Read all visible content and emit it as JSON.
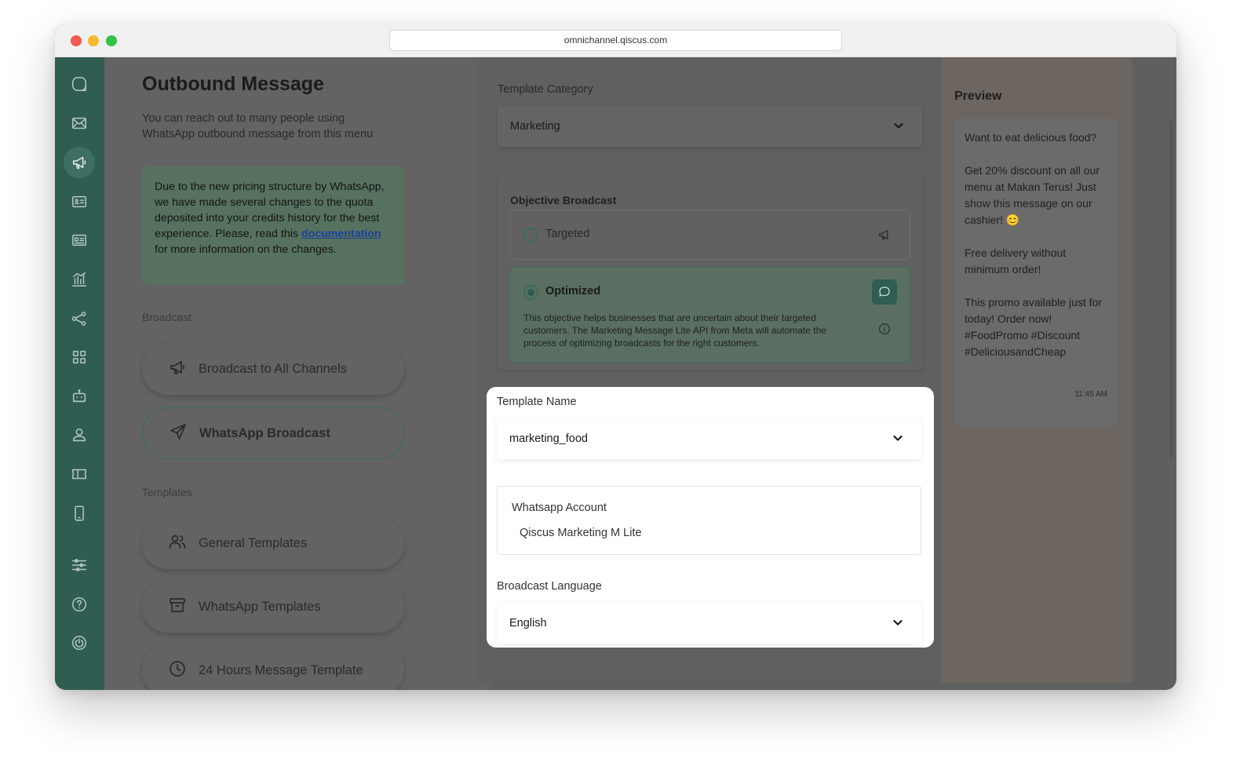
{
  "browser": {
    "url": "omnichannel.qiscus.com"
  },
  "sidebar": {
    "icons": [
      "logo-icon",
      "mail-icon",
      "megaphone-icon",
      "contact-card-icon",
      "id-card-icon",
      "analytics-icon",
      "integration-icon",
      "apps-grid-icon",
      "bot-icon",
      "agent-icon",
      "ticket-icon",
      "mobile-icon",
      "settings-sliders-icon",
      "help-icon",
      "power-icon"
    ],
    "active": "megaphone-icon"
  },
  "left": {
    "title": "Outbound Message",
    "subtitle": "You can reach out to many people using WhatsApp outbound message from this menu",
    "notice": {
      "text_before": "Due to the new pricing structure by WhatsApp, we have made several changes to the quota deposited into your credits history for the best experience. Please, read this ",
      "link": "documentation",
      "text_after": " for more information on the changes."
    },
    "broadcast_label": "Broadcast",
    "broadcast_items": [
      {
        "label": "Broadcast to All Channels",
        "icon": "megaphone-icon"
      },
      {
        "label": "WhatsApp Broadcast",
        "icon": "send-icon",
        "active": true
      }
    ],
    "templates_label": "Templates",
    "template_items": [
      {
        "label": "General Templates",
        "icon": "users-icon"
      },
      {
        "label": "WhatsApp Templates",
        "icon": "archive-icon"
      },
      {
        "label": "24 Hours Message Template",
        "icon": "clock-icon"
      }
    ]
  },
  "form": {
    "template_category": {
      "label": "Template Category",
      "value": "Marketing"
    },
    "objective": {
      "title": "Objective Broadcast",
      "options": [
        {
          "label": "Targeted",
          "selected": false,
          "icon": "megaphone-icon"
        },
        {
          "label": "Optimized",
          "selected": true,
          "icon": "chat-bubble-icon",
          "description": "This objective helps businesses that are uncertain about their targeted customers. The Marketing Message Lite API from Meta will automate the process of optimizing broadcasts for the right customers."
        }
      ]
    },
    "template_name": {
      "label": "Template Name",
      "value": "marketing_food"
    },
    "whatsapp_account": {
      "label": "Whatsapp Account",
      "value": "Qiscus Marketing M Lite"
    },
    "broadcast_language": {
      "label": "Broadcast Language",
      "value": "English"
    }
  },
  "preview": {
    "title": "Preview",
    "paragraphs": [
      "Want to eat delicious food?",
      "Get 20% discount on all our menu at Makan Terus! Just show this message on our cashier! 😊",
      "Free delivery without minimum order!",
      "This promo available just for today! Order now! #FoodPromo #Discount #DeliciousandCheap"
    ],
    "time": "11:45 AM"
  },
  "colors": {
    "brand": "#2f5d52",
    "overlay": "#5f5f5f",
    "panel": "#ffffff"
  }
}
